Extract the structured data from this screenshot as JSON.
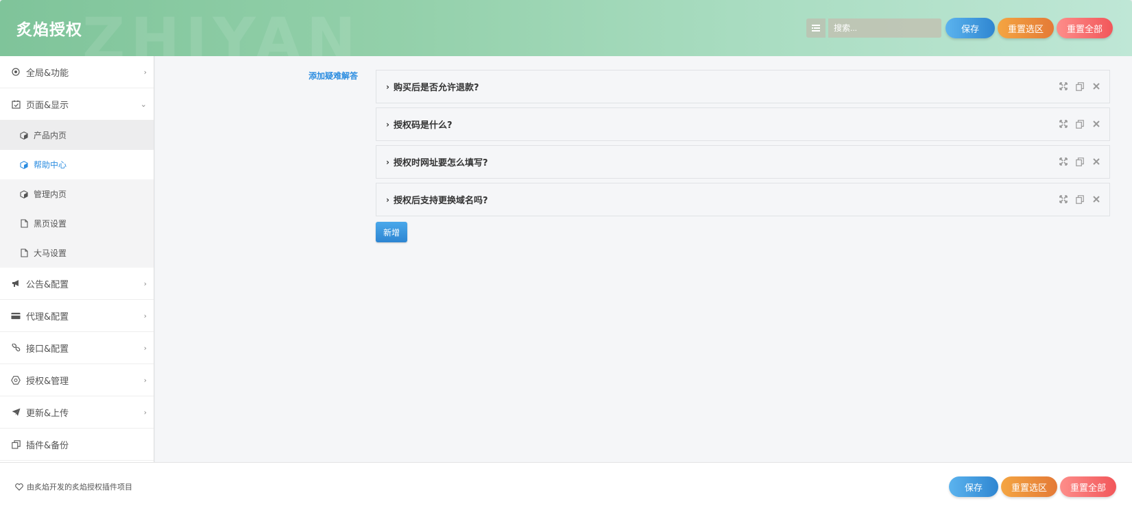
{
  "header": {
    "brand": "炙焰授权",
    "search_placeholder": "搜索...",
    "buttons": {
      "save": "保存",
      "reset_section": "重置选区",
      "reset_all": "重置全部"
    }
  },
  "sidebar": {
    "items": [
      {
        "label": "全局&功能",
        "icon": "target-icon",
        "chevron": "›"
      },
      {
        "label": "页面&显示",
        "icon": "calendar-check-icon",
        "chevron": "⌄",
        "expanded": true,
        "children": [
          {
            "label": "产品内页",
            "icon": "cube-icon"
          },
          {
            "label": "帮助中心",
            "icon": "cube-icon",
            "active": true
          },
          {
            "label": "管理内页",
            "icon": "cube-icon"
          },
          {
            "label": "黑页设置",
            "icon": "file-icon"
          },
          {
            "label": "大马设置",
            "icon": "file-icon"
          }
        ]
      },
      {
        "label": "公告&配置",
        "icon": "megaphone-icon",
        "chevron": "›"
      },
      {
        "label": "代理&配置",
        "icon": "credit-card-icon",
        "chevron": "›"
      },
      {
        "label": "接口&配置",
        "icon": "link-icon",
        "chevron": "›"
      },
      {
        "label": "授权&管理",
        "icon": "hexagon-icon",
        "chevron": "›"
      },
      {
        "label": "更新&上传",
        "icon": "paper-plane-icon",
        "chevron": "›"
      },
      {
        "label": "插件&备份",
        "icon": "copy-icon"
      }
    ]
  },
  "main": {
    "section_label": "添加疑难解答",
    "faqs": [
      {
        "question": "购买后是否允许退款?"
      },
      {
        "question": "授权码是什么?"
      },
      {
        "question": "授权时网址要怎么填写?"
      },
      {
        "question": "授权后支持更换域名吗?"
      }
    ],
    "add_button": "新增"
  },
  "footer": {
    "credit": "由炙焰开发的炙焰授权插件项目",
    "buttons": {
      "save": "保存",
      "reset_section": "重置选区",
      "reset_all": "重置全部"
    }
  },
  "colors": {
    "accent_blue": "#2c8de0",
    "header_green": "#8fcea6",
    "save_blue": "#3a93da",
    "reset_orange": "#ec8f3b",
    "reset_red": "#f56e6e"
  }
}
